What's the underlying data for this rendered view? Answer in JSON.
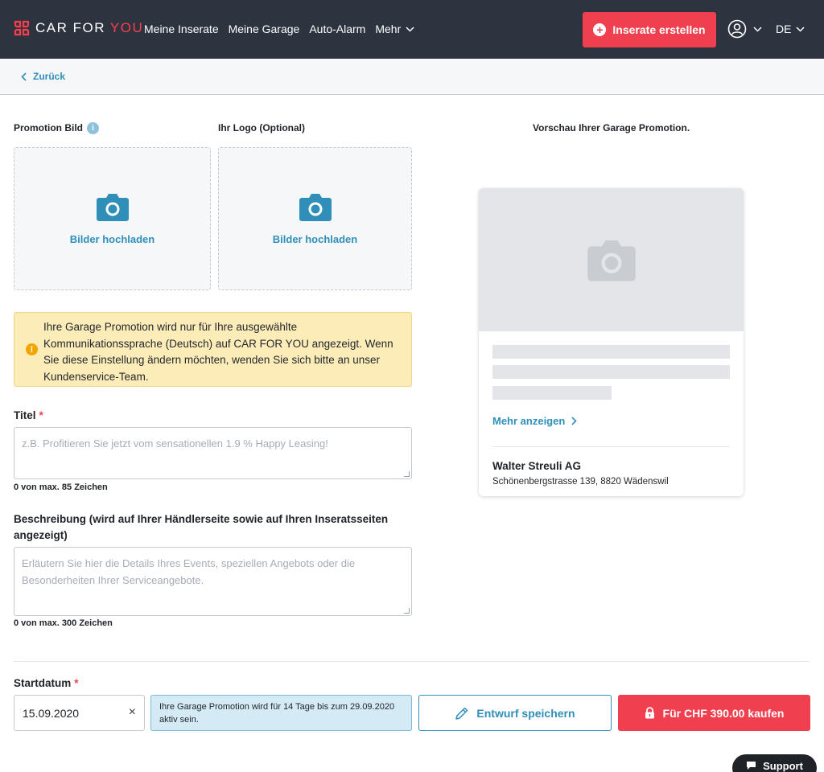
{
  "header": {
    "logo_car": "CAR FOR ",
    "logo_you": "YOU",
    "nav": [
      "Meine Inserate",
      "Meine Garage",
      "Auto-Alarm"
    ],
    "nav_more": "Mehr",
    "create_button": "Inserate erstellen",
    "language": "DE"
  },
  "back": {
    "label": "Zurück"
  },
  "uploads": {
    "promotion_label": "Promotion Bild",
    "logo_label": "Ihr Logo (Optional)",
    "upload_text": "Bilder hochladen"
  },
  "notice": {
    "text": "Ihre Garage Promotion wird nur für Ihre ausgewählte Kommunikationssprache (Deutsch) auf CAR FOR YOU angezeigt. Wenn Sie diese Einstellung ändern möchten, wenden Sie sich bitte an unser Kundenservice-Team."
  },
  "title_field": {
    "label": "Titel",
    "required": "*",
    "placeholder": "z.B. Profitieren Sie jetzt vom sensationellen 1.9 % Happy Leasing!",
    "counter": "0 von max. 85 Zeichen"
  },
  "description_field": {
    "label": "Beschreibung (wird auf Ihrer Händlerseite sowie auf Ihren Inseratsseiten angezeigt)",
    "placeholder": "Erläutern Sie hier die Details Ihres Events, speziellen Angebots oder die Besonderheiten Ihrer Serviceangebote.",
    "counter": "0 von max. 300 Zeichen"
  },
  "preview": {
    "heading": "Vorschau Ihrer Garage Promotion.",
    "more": "Mehr anzeigen",
    "company": "Walter Streuli AG",
    "address": "Schönenbergstrasse 139, 8820 Wädenswil"
  },
  "start": {
    "label": "Startdatum",
    "required": "*",
    "date": "15.09.2020",
    "clear": "×",
    "note": "Ihre Garage Promotion wird für 14 Tage bis zum 29.09.2020 aktiv sein.",
    "draft_button": "Entwurf speichern",
    "buy_button": "Für CHF 390.00 kaufen"
  },
  "support": {
    "label": "Support"
  },
  "colors": {
    "accent": "#2f8fb8",
    "brand_red": "#f0404f",
    "header_bg": "#2d3440",
    "notice_bg": "#fcecb8"
  }
}
